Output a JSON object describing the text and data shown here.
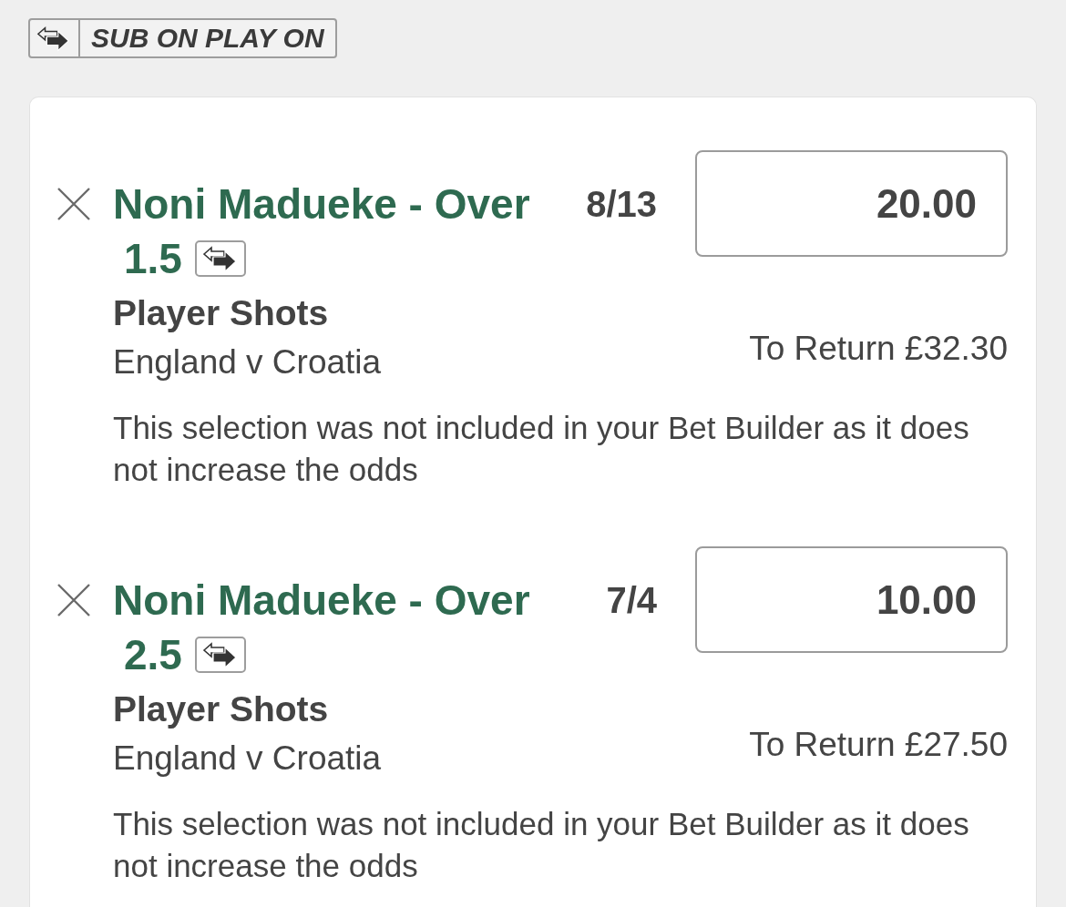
{
  "promo_badge": {
    "label": "SUB ON PLAY ON"
  },
  "bets": [
    {
      "selection": "Noni Madueke - Over 1.5",
      "sub_on_play_on": true,
      "odds": "8/13",
      "stake": "20.00",
      "market": "Player Shots",
      "event": "England v Croatia",
      "to_return": "To Return £32.30",
      "note": "This selection was not included in your Bet Builder as it does not increase the odds"
    },
    {
      "selection": "Noni Madueke - Over 2.5",
      "sub_on_play_on": true,
      "odds": "7/4",
      "stake": "10.00",
      "market": "Player Shots",
      "event": "England v Croatia",
      "to_return": "To Return £27.50",
      "note": "This selection was not included in your Bet Builder as it does not increase the odds"
    }
  ]
}
